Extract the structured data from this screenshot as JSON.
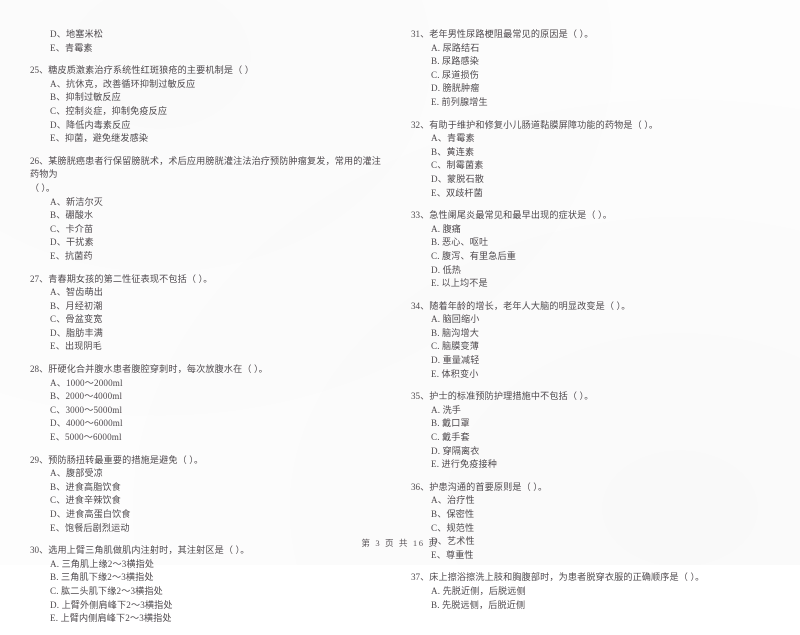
{
  "document": {
    "footer": "第 3 页  共 16 页",
    "page_number": "3",
    "total_pages": "16"
  },
  "left_column": [
    {
      "stem": "",
      "continued_options": [
        "D、地塞米松",
        "E、青霉素"
      ]
    },
    {
      "number": "25、",
      "stem": "糖皮质激素治疗系统性红斑狼疮的主要机制是（      ）",
      "options": [
        "A、抗休克，改善循环抑制过敏反应",
        "B、抑制过敏反应",
        "C、控制炎症，抑制免疫反应",
        "D、降低内毒素反应",
        "E、抑菌，避免继发感染"
      ]
    },
    {
      "number": "26、",
      "stem": "某膀胱癌患者行保留膀胱术，术后应用膀胱灌注法治疗预防肿瘤复发，常用的灌注药物为",
      "stem_cont": "（      ）。",
      "options": [
        "A、新洁尔灭",
        "B、硼酸水",
        "C、卡介苗",
        "D、干扰素",
        "E、抗菌药"
      ]
    },
    {
      "number": "27、",
      "stem": "青春期女孩的第二性征表现不包括（      ）。",
      "options": [
        "A、智齿萌出",
        "B、月经初潮",
        "C、骨盆变宽",
        "D、脂肪丰满",
        "E、出现阴毛"
      ]
    },
    {
      "number": "28、",
      "stem": "肝硬化合并腹水患者腹腔穿刺时，每次放腹水在（      ）。",
      "options": [
        "A、1000～2000ml",
        "B、2000～4000ml",
        "C、3000～5000ml",
        "D、4000～6000ml",
        "E、5000～6000ml"
      ]
    },
    {
      "number": "29、",
      "stem": "预防肠扭转最重要的措施是避免（      ）。",
      "options": [
        "A、腹部受凉",
        "B、进食高脂饮食",
        "C、进食辛辣饮食",
        "D、进食高蛋白饮食",
        "E、饱餐后剧烈运动"
      ]
    },
    {
      "number": "30、",
      "stem": "选用上臂三角肌做肌内注射时，其注射区是（      ）。",
      "options": [
        "A. 三角肌上缘2～3横指处",
        "B. 三角肌下缘2～3横指处",
        "C. 肱二头肌下缘2～3横指处",
        "D. 上臂外侧肩峰下2～3横指处",
        "E. 上臂内侧肩峰下2～3横指处"
      ]
    }
  ],
  "right_column": [
    {
      "number": "31、",
      "stem": "老年男性尿路梗阻最常见的原因是（      ）。",
      "options": [
        "A. 尿路结石",
        "B. 尿路感染",
        "C. 尿道损伤",
        "D. 膀胱肿瘤",
        "E. 前列腺增生"
      ]
    },
    {
      "number": "32、",
      "stem": "有助于维护和修复小儿肠道黏膜屏障功能的药物是（      ）。",
      "options": [
        "A、青霉素",
        "B、黄连素",
        "C、制霉菌素",
        "D、蒙脱石散",
        "E、双歧杆菌"
      ]
    },
    {
      "number": "33、",
      "stem": "急性阑尾炎最常见和最早出现的症状是（      ）。",
      "options": [
        "A. 腹痛",
        "B. 恶心、呕吐",
        "C. 腹泻、有里急后重",
        "D. 低热",
        "E. 以上均不是"
      ]
    },
    {
      "number": "34、",
      "stem": "随着年龄的增长，老年人大脑的明显改变是（      ）。",
      "options": [
        "A. 脑回缩小",
        "B. 脑沟增大",
        "C. 脑膜变薄",
        "D. 重量减轻",
        "E. 体积变小"
      ]
    },
    {
      "number": "35、",
      "stem": "护士的标准预防护理措施中不包括（      ）。",
      "options": [
        "A. 洗手",
        "B. 戴口罩",
        "C. 戴手套",
        "D. 穿隔离衣",
        "E. 进行免疫接种"
      ]
    },
    {
      "number": "36、",
      "stem": "护患沟通的首要原则是（      ）。",
      "options": [
        "A、治疗性",
        "B、保密性",
        "C、规范性",
        "D、艺术性",
        "E、尊重性"
      ]
    },
    {
      "number": "37、",
      "stem": "床上擦浴擦洗上肢和胸腹部时，为患者脱穿衣服的正确顺序是（      ）。",
      "options": [
        "A. 先脱近侧，后脱远侧",
        "B. 先脱远侧，后脱近侧"
      ]
    }
  ]
}
